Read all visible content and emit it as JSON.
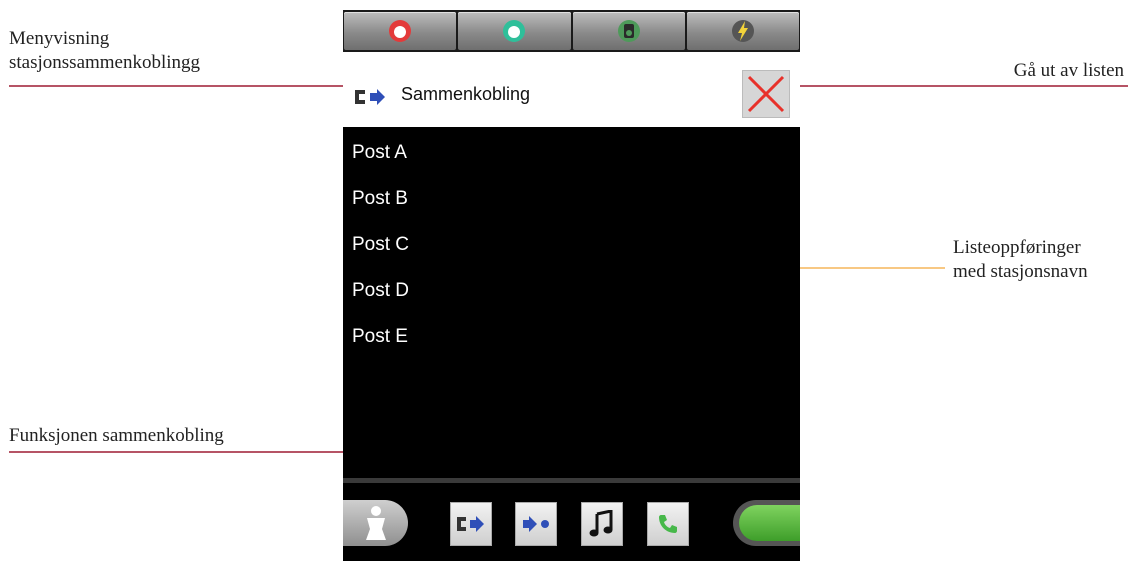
{
  "annotations": {
    "menu_view": {
      "line1": "Menyvisning",
      "line2": "stasjonssammenkoblingg"
    },
    "exit_list": "Gå ut av listen",
    "list_entries": {
      "line1": "Listeoppføringer",
      "line2": "med stasjonsnavn"
    },
    "connect_function": "Funksjonen sammenkobling"
  },
  "colors": {
    "annotation_line_dark": "#9e1b32",
    "annotation_line_light": "#f5b55a",
    "close_x": "#e8312a",
    "icon_blue": "#2f4fb8",
    "phone_green": "#47b84a"
  },
  "top_tabs": [
    {
      "icon": "red-alarm-icon"
    },
    {
      "icon": "green-status-icon"
    },
    {
      "icon": "speaker-icon"
    },
    {
      "icon": "lightning-icon"
    }
  ],
  "header": {
    "title": "Sammenkobling",
    "icon": "connect-icon",
    "close_icon": "close-icon"
  },
  "list": [
    "Post A",
    "Post B",
    "Post C",
    "Post D",
    "Post E"
  ],
  "bottom_toolbar": [
    {
      "icon": "person-icon"
    },
    {
      "icon": "connect-icon"
    },
    {
      "icon": "forward-dot-icon"
    },
    {
      "icon": "music-note-icon"
    },
    {
      "icon": "phone-icon"
    }
  ]
}
